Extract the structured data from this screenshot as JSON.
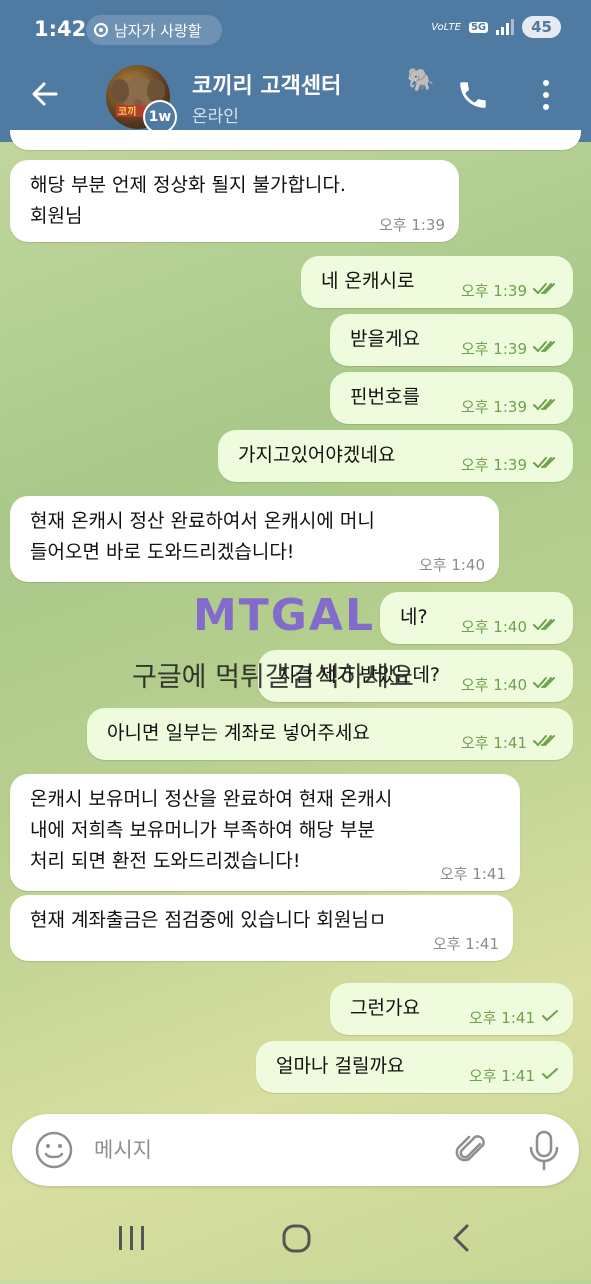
{
  "status_bar": {
    "time": "1:42",
    "ticker": "남자가 사랑할",
    "network": "5G",
    "volte": "VoLTE",
    "battery": "45"
  },
  "header": {
    "title": "코끼리 고객센터",
    "status": "온라인",
    "story_badge": "1w",
    "avatar_icon": "elephant-avatar",
    "emoji": "🐘",
    "bg_color": "#4f7ba3"
  },
  "messages": [
    {
      "dir": "in",
      "lines": [
        "해당 부분 언제 정상화 될지 불가합니다.",
        "회원님"
      ],
      "time": "오후 1:39"
    },
    {
      "dir": "out",
      "lines": [
        "네 온캐시로"
      ],
      "time": "오후 1:39",
      "read": true
    },
    {
      "dir": "out",
      "lines": [
        "받을게요"
      ],
      "time": "오후 1:39",
      "read": true
    },
    {
      "dir": "out",
      "lines": [
        "핀번호를"
      ],
      "time": "오후 1:39",
      "read": true
    },
    {
      "dir": "out",
      "lines": [
        "가지고있어야겠네요"
      ],
      "time": "오후 1:39",
      "read": true
    },
    {
      "dir": "in",
      "lines": [
        "현재 온캐시 정산 완료하여서 온캐시에 머니",
        "들어오면 바로 도와드리겠습니다!"
      ],
      "time": "오후 1:40"
    },
    {
      "dir": "out",
      "lines": [
        "네?"
      ],
      "time": "오후 1:40",
      "read": true
    },
    {
      "dir": "out",
      "lines": [
        "지금 제가 받았는데?"
      ],
      "time": "오후 1:40",
      "read": true
    },
    {
      "dir": "out",
      "lines": [
        "아니면 일부는 계좌로 넣어주세요"
      ],
      "time": "오후 1:41",
      "read": true
    },
    {
      "dir": "in",
      "lines": [
        "온캐시 보유머니 정산을 완료하여 현재 온캐시",
        "내에 저희측 보유머니가 부족하여 해당 부분",
        "처리 되면 환전 도와드리겠습니다!"
      ],
      "time": "오후 1:41"
    },
    {
      "dir": "in",
      "lines": [
        "현재 계좌출금은 점검중에 있습니다  회원님ㅁ"
      ],
      "time": "오후 1:41"
    },
    {
      "dir": "out",
      "lines": [
        "그런가요"
      ],
      "time": "오후 1:41",
      "read": false
    },
    {
      "dir": "out",
      "lines": [
        "얼마나 걸릴까요"
      ],
      "time": "오후 1:41",
      "read": false
    }
  ],
  "watermark": {
    "logo": "MTGAL",
    "tagline": "구글에 먹튀갤검색하세요"
  },
  "input": {
    "placeholder": "메시지"
  },
  "colors": {
    "outgoing_bubble": "#eefbdc",
    "incoming_bubble": "#ffffff",
    "check_color": "#6fa14f"
  }
}
